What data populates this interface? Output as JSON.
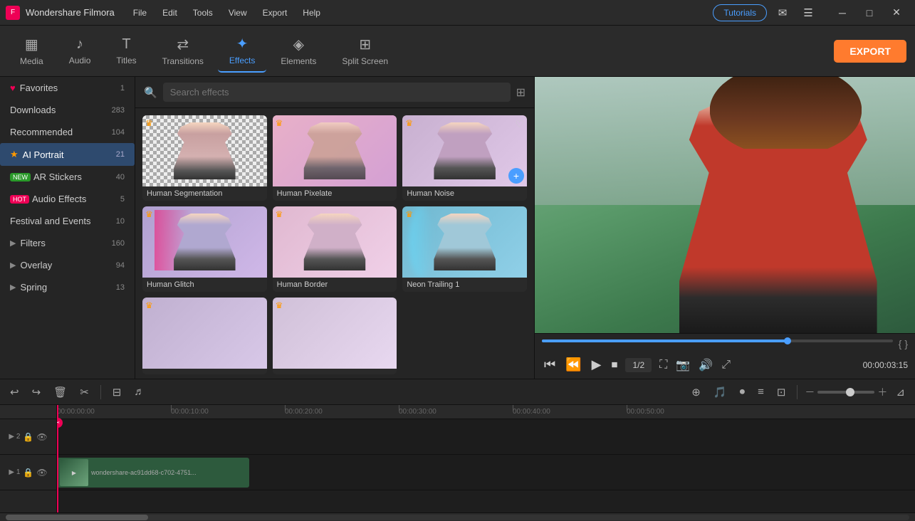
{
  "app": {
    "name": "Wondershare Filmora",
    "logo": "F"
  },
  "titlebar": {
    "menus": [
      "File",
      "Edit",
      "Tools",
      "View",
      "Export",
      "Help"
    ],
    "tutorials_label": "Tutorials",
    "window_controls": [
      "─",
      "□",
      "✕"
    ]
  },
  "toolbar": {
    "items": [
      {
        "id": "media",
        "icon": "▦",
        "label": "Media"
      },
      {
        "id": "audio",
        "icon": "♪",
        "label": "Audio"
      },
      {
        "id": "titles",
        "icon": "T",
        "label": "Titles"
      },
      {
        "id": "transitions",
        "icon": "⇄",
        "label": "Transitions"
      },
      {
        "id": "effects",
        "icon": "✦",
        "label": "Effects"
      },
      {
        "id": "elements",
        "icon": "◈",
        "label": "Elements"
      },
      {
        "id": "split_screen",
        "icon": "⊞",
        "label": "Split Screen"
      }
    ],
    "export_label": "EXPORT"
  },
  "sidebar": {
    "items": [
      {
        "id": "favorites",
        "icon": "♥",
        "label": "Favorites",
        "count": "1",
        "badge": ""
      },
      {
        "id": "downloads",
        "icon": "",
        "label": "Downloads",
        "count": "283",
        "badge": ""
      },
      {
        "id": "recommended",
        "icon": "",
        "label": "Recommended",
        "count": "104",
        "badge": ""
      },
      {
        "id": "ai_portrait",
        "icon": "★",
        "label": "AI Portrait",
        "count": "21",
        "badge": ""
      },
      {
        "id": "ar_stickers",
        "icon": "",
        "label": "AR Stickers",
        "count": "40",
        "badge": "NEW"
      },
      {
        "id": "audio_effects",
        "icon": "",
        "label": "Audio Effects",
        "count": "5",
        "badge": "HOT"
      },
      {
        "id": "festival_events",
        "icon": "",
        "label": "Festival and Events",
        "count": "10",
        "badge": ""
      },
      {
        "id": "filters",
        "icon": "",
        "label": "Filters",
        "count": "160",
        "badge": ""
      },
      {
        "id": "overlay",
        "icon": "",
        "label": "Overlay",
        "count": "94",
        "badge": ""
      },
      {
        "id": "spring",
        "icon": "",
        "label": "Spring",
        "count": "13",
        "badge": ""
      }
    ]
  },
  "effects": {
    "search_placeholder": "Search effects",
    "cards": [
      {
        "id": "human_seg",
        "label": "Human Segmentation",
        "crown": true,
        "add_btn": false,
        "heart": false,
        "thumb_type": "checkered"
      },
      {
        "id": "human_pixelate",
        "label": "Human Pixelate",
        "crown": true,
        "add_btn": false,
        "heart": false,
        "thumb_type": "pink"
      },
      {
        "id": "human_noise",
        "label": "Human Noise",
        "crown": true,
        "add_btn": true,
        "heart": true,
        "thumb_type": "pink2"
      },
      {
        "id": "human_glitch",
        "label": "Human Glitch",
        "crown": true,
        "add_btn": false,
        "heart": false,
        "thumb_type": "glitch"
      },
      {
        "id": "human_border",
        "label": "Human Border",
        "crown": true,
        "add_btn": false,
        "heart": false,
        "thumb_type": "border"
      },
      {
        "id": "neon_trailing_1",
        "label": "Neon Trailing 1",
        "crown": true,
        "add_btn": false,
        "heart": false,
        "thumb_type": "neon"
      },
      {
        "id": "partial1",
        "label": "",
        "crown": true,
        "add_btn": false,
        "heart": false,
        "thumb_type": "partial"
      },
      {
        "id": "partial2",
        "label": "",
        "crown": true,
        "add_btn": false,
        "heart": false,
        "thumb_type": "partial2"
      }
    ]
  },
  "preview": {
    "time_current": "00:00:03:15",
    "fraction": "1/2",
    "timeline_brackets_left": "{",
    "timeline_brackets_right": "}"
  },
  "timeline": {
    "timestamps": [
      "00:00:00:00",
      "00:00:10:00",
      "00:00:20:00",
      "00:00:30:00",
      "00:00:40:00",
      "00:00:50:00"
    ],
    "tracks": [
      {
        "id": "track2",
        "label": "▶ 2",
        "icons": [
          "🔒",
          "👁"
        ]
      },
      {
        "id": "track1",
        "label": "▶ 1",
        "icons": [
          "🔒",
          "👁"
        ]
      }
    ],
    "clip": {
      "label": "wondershare-ac91dd68-c702-4751..."
    }
  }
}
